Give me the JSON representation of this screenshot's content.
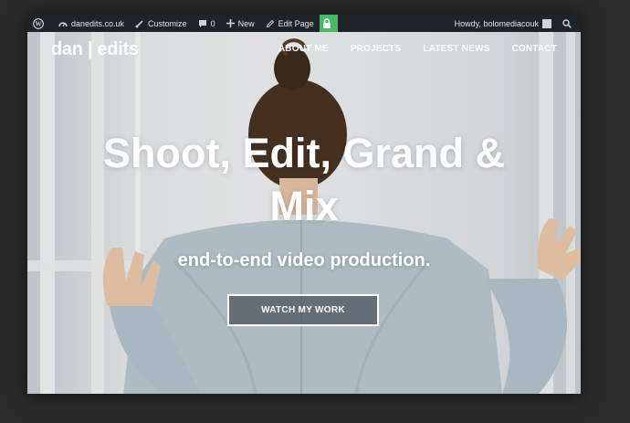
{
  "adminbar": {
    "site": "danedits.co.uk",
    "customize": "Customize",
    "comments": "0",
    "new": "New",
    "edit_page": "Edit Page",
    "howdy": "Howdy, bolomediacouk"
  },
  "nav": {
    "logo": "dan | edits",
    "items": [
      "ABOUT ME",
      "PROJECTS",
      "LATEST NEWS",
      "CONTACT"
    ]
  },
  "hero": {
    "headline_line1": "Shoot, Edit, Grand &",
    "headline_line2": "Mix",
    "subheadline": "end-to-end video production.",
    "cta": "WATCH MY WORK"
  },
  "colors": {
    "adminbar_bg": "#1d2327",
    "lock_green": "#4ab866",
    "page_bg": "#2a2a2a"
  }
}
